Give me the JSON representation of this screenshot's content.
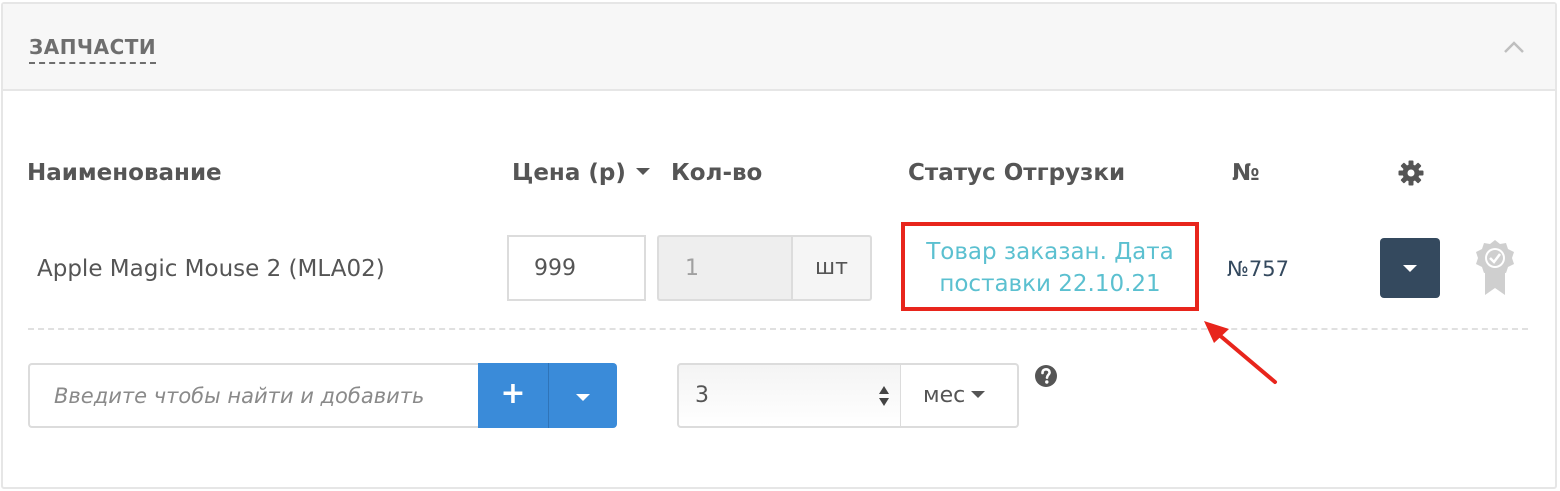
{
  "panel": {
    "title": "ЗАПЧАСТИ",
    "collapse_icon": "chevron-up-icon"
  },
  "table": {
    "headers": {
      "name": "Наименование",
      "price": "Цена (р)",
      "qty": "Кол-во",
      "status": "Статус Отгрузки",
      "number": "№",
      "settings_icon": "gear-icon"
    },
    "rows": [
      {
        "name": "Apple Magic Mouse 2 (MLA02)",
        "price": "999",
        "qty": "1",
        "unit": "шт",
        "status": "Товар заказан. Дата поставки 22.10.21",
        "number": "№757",
        "award_icon": "award-badge-icon"
      }
    ]
  },
  "add_item": {
    "placeholder": "Введите чтобы найти и добавить",
    "add_label": "+"
  },
  "period": {
    "value": "3",
    "unit": "мес"
  },
  "colors": {
    "status_text": "#5bc0d0",
    "annotation": "#e8251c",
    "primary_button": "#3a8bd9",
    "dark_button": "#34495e"
  }
}
